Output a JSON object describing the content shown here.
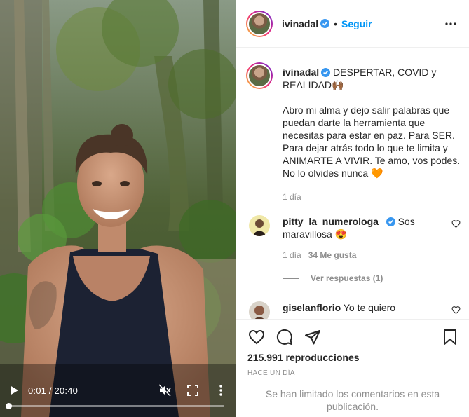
{
  "video": {
    "time_display": "0:01 / 20:40",
    "progress": 0.0008
  },
  "header": {
    "username": "ivinadal",
    "separator": "•",
    "follow_label": "Seguir"
  },
  "caption": {
    "username": "ivinadal",
    "title": "DESPERTAR, COVID y REALIDAD🙌🏾",
    "body": "Abro mi alma y dejo salir palabras que puedan darte la herramienta que necesitas para estar en paz. Para SER. Para dejar atrás todo lo que te limita y ANIMARTE A VIVIR. Te amo, vos podes. No lo olvides nunca 🧡",
    "time": "1 día"
  },
  "comments": [
    {
      "username": "pitty_la_numerologa_",
      "text": "Sos maravillosa 😍",
      "time": "1 día",
      "likes": "34 Me gusta",
      "replies_label": "Ver respuestas (1)"
    },
    {
      "username": "giselanflorio",
      "text": "Yo te quiero"
    }
  ],
  "stats": {
    "views": "215.991 reproducciones",
    "posted": "HACE UN DÍA"
  },
  "footer": {
    "limited_comments": "Se han limitado los comentarios en esta publicación."
  },
  "colors": {
    "accent": "#0095f6",
    "verified": "#3897f0",
    "text": "#262626",
    "muted": "#8e8e8e",
    "border": "#dbdbdb"
  },
  "icons": [
    "play-icon",
    "mute-icon",
    "fullscreen-icon",
    "video-more-icon",
    "verified-badge-icon",
    "more-options-icon",
    "heart-icon",
    "comment-icon",
    "share-icon",
    "bookmark-icon",
    "comment-like-icon"
  ]
}
